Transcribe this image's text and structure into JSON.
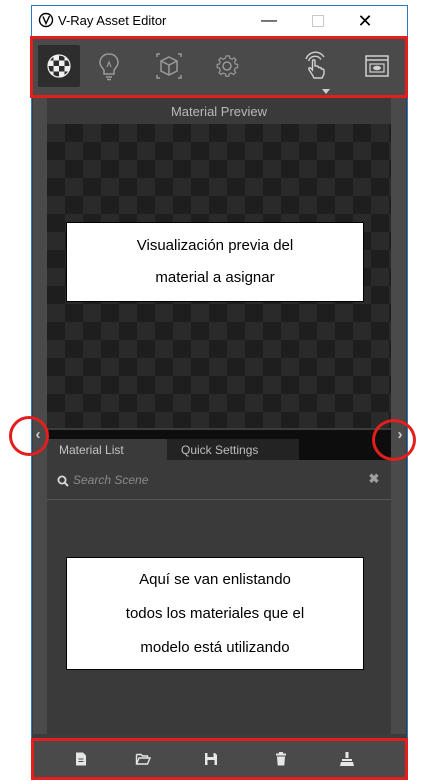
{
  "window": {
    "title": "V-Ray Asset Editor",
    "minimize": "—",
    "close": "✕"
  },
  "toolbar": {
    "buttons": [
      "materials-tab-icon",
      "lights-tab-icon",
      "geometry-tab-icon",
      "settings-tab-icon",
      "interactive-render-icon",
      "frame-buffer-icon"
    ],
    "active": "materials"
  },
  "preview": {
    "header": "Material Preview",
    "callout_line1": "Visualización previa del",
    "callout_line2": "material a asignar"
  },
  "tabs": {
    "material_list": "Material List",
    "quick_settings": "Quick Settings"
  },
  "search": {
    "placeholder": "Search Scene",
    "clear": "✖"
  },
  "list": {
    "callout_line1": "Aquí se van enlistando",
    "callout_line2": "todos los materiales que el",
    "callout_line3": "modelo está utilizando"
  },
  "arrows": {
    "left": "‹",
    "right": "›"
  },
  "bottom_bar": {
    "buttons": [
      "new-file-icon",
      "open-folder-icon",
      "save-icon",
      "trash-icon",
      "purge-icon"
    ]
  },
  "colors": {
    "annotation_red": "#e41d1d",
    "panel_dark": "#3a3a3a",
    "toolbar_bg": "#4a4a4a"
  }
}
